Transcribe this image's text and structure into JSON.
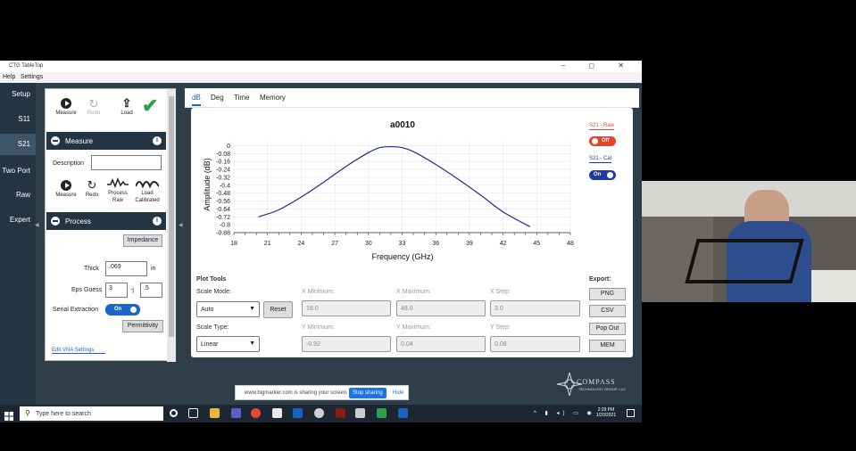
{
  "window": {
    "title": "CTG TableTop",
    "controls": "–  ◻  ✕"
  },
  "menu": [
    "Help",
    "Settings"
  ],
  "nav": [
    "Setup",
    "S11",
    "S21",
    "Two Port",
    "Raw",
    "Expert"
  ],
  "toolbar": {
    "measure": "Measure",
    "redo": "Redo",
    "load": "Load"
  },
  "measure_section": {
    "title": "Measure",
    "description_label": "Description",
    "description_value": "",
    "buttons": [
      "Measure",
      "Redo",
      "Process Raw",
      "Load Calibrated"
    ]
  },
  "process_section": {
    "title": "Process",
    "impedance_btn": "Impedance",
    "thick_label": "Thick",
    "thick_value": ".069",
    "thick_unit": "in",
    "eps_label": "Eps Guess",
    "eps_real": "3",
    "eps_sep": "-j",
    "eps_imag": ".5",
    "serial_label": "Serial Extraction",
    "serial_state": "On",
    "permittivity_btn": "Permittivity",
    "edit_vna": "Edit VNA Settings"
  },
  "tabs": [
    "dB",
    "Deg",
    "Time",
    "Memory"
  ],
  "legend": {
    "raw_label": "S21 - Raw",
    "raw_state": "Off",
    "raw_color": "#e8412c",
    "cal_label": "S21 - Cal",
    "cal_state": "On",
    "cal_color": "#1f3aa3"
  },
  "chart_data": {
    "type": "line",
    "title": "a0010",
    "xlabel": "Frequency (GHz)",
    "ylabel": "Amplitude (dB)",
    "xlim": [
      18,
      48
    ],
    "ylim": [
      -0.88,
      0.04
    ],
    "xticks": [
      "18",
      "21",
      "24",
      "27",
      "30",
      "33",
      "36",
      "39",
      "42",
      "45",
      "48"
    ],
    "yticks": [
      "0",
      "-0.08",
      "-0.16",
      "-0.24",
      "-0.32",
      "-0.4",
      "-0.48",
      "-0.56",
      "-0.64",
      "-0.72",
      "-0.8",
      "-0.88"
    ],
    "grid": true,
    "series": [
      {
        "name": "S21 - Cal",
        "x": [
          20.2,
          22,
          24,
          26,
          28,
          30,
          31,
          32,
          33,
          34,
          36,
          38,
          40,
          42,
          44.4
        ],
        "y": [
          -0.72,
          -0.65,
          -0.52,
          -0.37,
          -0.21,
          -0.07,
          -0.02,
          -0.01,
          -0.02,
          -0.06,
          -0.19,
          -0.34,
          -0.5,
          -0.67,
          -0.82
        ]
      }
    ]
  },
  "plot_tools": {
    "title": "Plot Tools",
    "scale_mode_label": "Scale Mode:",
    "scale_mode": "Auto",
    "reset": "Reset",
    "scale_type_label": "Scale Type:",
    "scale_type": "Linear",
    "x_min_label": "X Minimum:",
    "x_min": "18.0",
    "x_max_label": "X Maximum:",
    "x_max": "48.0",
    "x_step_label": "X Step:",
    "x_step": "3.0",
    "y_min_label": "Y Minimum:",
    "y_min": "-0.92",
    "y_max_label": "Y Maximum:",
    "y_max": "0.04",
    "y_step_label": "Y Step:",
    "y_step": "0.08"
  },
  "export": {
    "title": "Export:",
    "buttons": [
      "PNG",
      "CSV",
      "Pop Out",
      "MEM"
    ]
  },
  "logo": {
    "name": "COMPASS",
    "sub": "TECHNOLOGY GROUP, LLC"
  },
  "sharebar": {
    "text": "www.bigmarker.com is sharing your screen.",
    "stop": "Stop sharing",
    "hide": "Hide"
  },
  "taskbar": {
    "search": "Type here to search",
    "time": "2:29 PM",
    "date": "1/20/2021"
  }
}
